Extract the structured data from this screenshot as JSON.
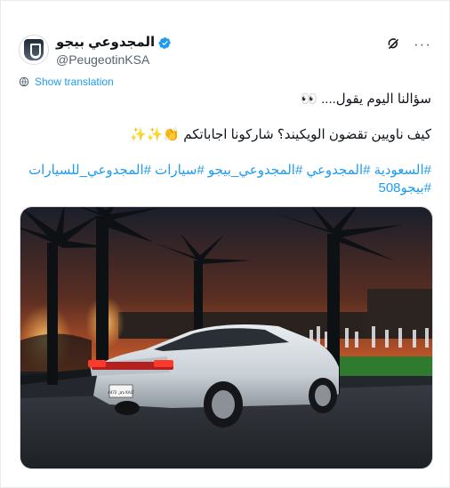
{
  "tweet": {
    "author": {
      "display_name": "المجدوعي بيجو",
      "handle": "@PeugeotinKSA",
      "verified": true
    },
    "show_translation_label": "Show translation",
    "text_line1": "سؤالنا اليوم يقول.... 👀",
    "text_line2": "كيف ناويين تقضون الويكيند؟ شاركونا اجاباتكم 👏✨✨",
    "hashtags": "#السعودية #المجدوعي #المجدوعي_بيجو #سيارات #المجدوعي_للسيارات #بيجو508",
    "media": {
      "plate_text": "تاكل 4472 KALT"
    }
  },
  "colors": {
    "link": "#1d9bf0",
    "verified": "#1d9bf0",
    "secondary_text": "#536471"
  },
  "icons": {
    "verified": "verified-badge-icon",
    "grok": "grok-icon",
    "more": "more-options-icon",
    "translate": "translate-globe-icon"
  }
}
